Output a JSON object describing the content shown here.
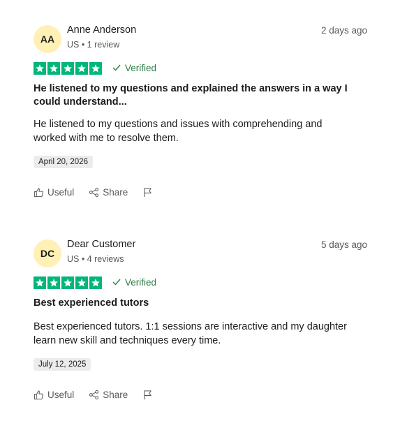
{
  "colors": {
    "star_green": "#00b67a",
    "verified_green": "#2e7d47",
    "avatar_bg": "#fff0b5",
    "muted_text": "#5a5a5a",
    "date_badge_bg": "#ececec"
  },
  "reviews": [
    {
      "initials": "AA",
      "name": "Anne Anderson",
      "meta": "US • 1 review",
      "date": "2 days ago",
      "rating": 5,
      "verified_label": "Verified",
      "title": "He listened to my questions and explained the answers in a way I could understand...",
      "body": "He listened to my questions and issues with comprehending and worked with me to resolve them.",
      "experience_date": "April 20, 2026",
      "useful_label": "Useful",
      "share_label": "Share"
    },
    {
      "initials": "DC",
      "name": "Dear Customer",
      "meta": "US • 4 reviews",
      "date": "5 days ago",
      "rating": 5,
      "verified_label": "Verified",
      "title": "Best experienced tutors",
      "body": "Best experienced tutors. 1:1 sessions are interactive and my daughter learn new skill and techniques every time.",
      "experience_date": "July 12, 2025",
      "useful_label": "Useful",
      "share_label": "Share"
    }
  ],
  "icons": {
    "star": "star-icon",
    "check": "check-icon",
    "useful": "thumbs-up-icon",
    "share": "share-icon",
    "report": "flag-icon"
  }
}
